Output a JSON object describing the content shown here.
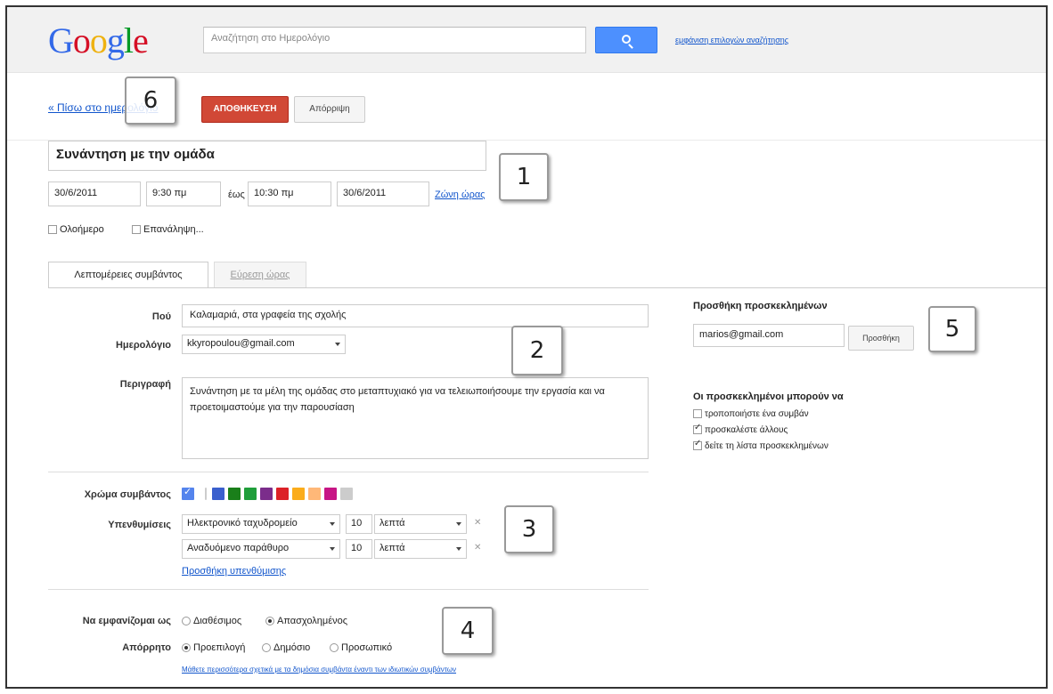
{
  "header": {
    "logo_letters": [
      {
        "ch": "G",
        "color": "#3369e8"
      },
      {
        "ch": "o",
        "color": "#d50f25"
      },
      {
        "ch": "o",
        "color": "#eeb211"
      },
      {
        "ch": "g",
        "color": "#3369e8"
      },
      {
        "ch": "l",
        "color": "#009925"
      },
      {
        "ch": "e",
        "color": "#d50f25"
      }
    ],
    "search_placeholder": "Αναζήτηση στο Ημερολόγιο",
    "search_icon": "search-icon",
    "search_options_link": "εμφάνιση επιλογών αναζήτησης"
  },
  "actions": {
    "back_link": "« Πίσω στο ημερολόγιο",
    "save_label": "ΑΠΟΘΗΚΕΥΣΗ",
    "discard_label": "Απόρριψη"
  },
  "event": {
    "title": "Συνάντηση με την ομάδα",
    "start_date": "30/6/2011",
    "start_time": "9:30 πμ",
    "until_label": "έως",
    "end_time": "10:30 πμ",
    "end_date": "30/6/2011",
    "timezone_link": "Ζώνη ώρας",
    "all_day_label": "Ολοήμερο",
    "repeat_label": "Επανάληψη..."
  },
  "tabs": {
    "details": "Λεπτομέρειες συμβάντος",
    "find_time": "Εύρεση ώρας"
  },
  "details": {
    "where_label": "Πού",
    "where_value": "Καλαμαριά, στα γραφεία της σχολής",
    "calendar_label": "Ημερολόγιο",
    "calendar_value": "kkyropoulou@gmail.com",
    "description_label": "Περιγραφή",
    "description_value": "Συνάντηση με τα μέλη της ομάδας στο μεταπτυχιακό για να τελειωποιήσουμε την εργασία και να προετοιμαστούμε για την παρουσίαση",
    "color_label": "Χρώμα συμβάντος",
    "colors": [
      "#5484ed",
      "#3a5fcd",
      "#1a7f1a",
      "#7b2d8b",
      "#dc2127",
      "#fbd75b",
      "#ffb878",
      "#c71585",
      "#cccccc"
    ],
    "reminders_label": "Υπενθυμίσεις",
    "reminders": [
      {
        "method": "Ηλεκτρονικό ταχυδρομείο",
        "value": "10",
        "unit": "λεπτά"
      },
      {
        "method": "Αναδυόμενο παράθυρο",
        "value": "10",
        "unit": "λεπτά"
      }
    ],
    "add_reminder_link": "Προσθήκη υπενθύμισης",
    "show_as_label": "Να εμφανίζομαι ως",
    "show_as_options": [
      "Διαθέσιμος",
      "Απασχολημένος"
    ],
    "privacy_label": "Απόρρητο",
    "privacy_options": [
      "Προεπιλογή",
      "Δημόσιο",
      "Προσωπικό"
    ],
    "privacy_link": "Μάθετε περισσότερα σχετικά με τα δημόσια συμβάντα έναντι των ιδιωτικών συμβάντων"
  },
  "guests": {
    "title": "Προσθήκη προσκεκλημένων",
    "input_value": "marios@gmail.com",
    "add_button": "Προσθήκη",
    "permissions_title": "Οι προσκεκλημένοι μπορούν να",
    "permissions": [
      {
        "label": "τροποποιήστε ένα συμβάν",
        "checked": false
      },
      {
        "label": "προσκαλέστε άλλους",
        "checked": true
      },
      {
        "label": "δείτε τη λίστα προσκεκλημένων",
        "checked": true
      }
    ]
  },
  "badges": [
    "1",
    "2",
    "3",
    "4",
    "5",
    "6"
  ]
}
